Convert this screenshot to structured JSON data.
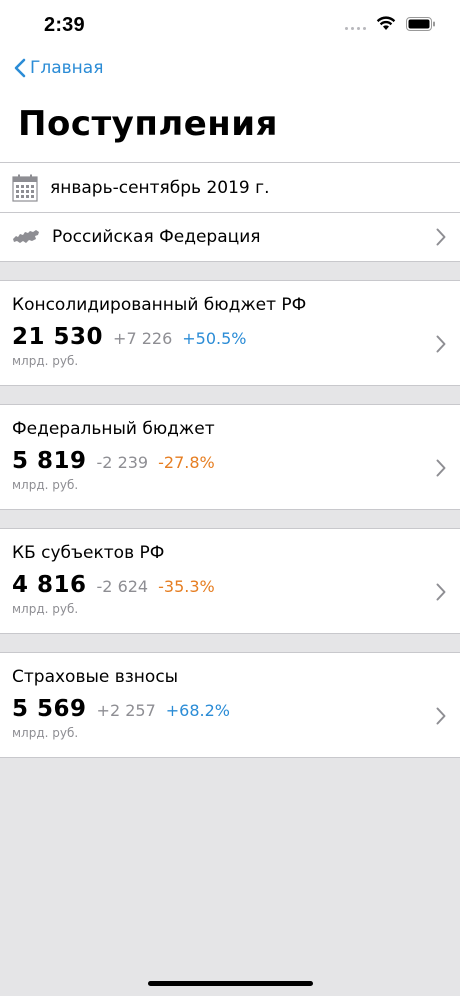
{
  "status": {
    "time": "2:39"
  },
  "nav": {
    "back_label": "Главная",
    "title": "Поступления"
  },
  "filters": {
    "period": "январь-сентябрь 2019 г.",
    "region": "Российская Федерация"
  },
  "cards": [
    {
      "title": "Консолидированный бюджет РФ",
      "value": "21 530",
      "delta": "+7 226",
      "percent": "+50.5%",
      "unit": "млрд. руб."
    },
    {
      "title": "Федеральный бюджет",
      "value": "5 819",
      "delta": "-2 239",
      "percent": "-27.8%",
      "unit": "млрд. руб."
    },
    {
      "title": "КБ субъектов РФ",
      "value": "4 816",
      "delta": "-2 624",
      "percent": "-35.3%",
      "unit": "млрд. руб."
    },
    {
      "title": "Страховые взносы",
      "value": "5 569",
      "delta": "+2 257",
      "percent": "+68.2%",
      "unit": "млрд. руб."
    }
  ],
  "colors": {
    "accent": "#2b8cd6",
    "negative": "#e67e22",
    "background": "#e5e5e7"
  }
}
